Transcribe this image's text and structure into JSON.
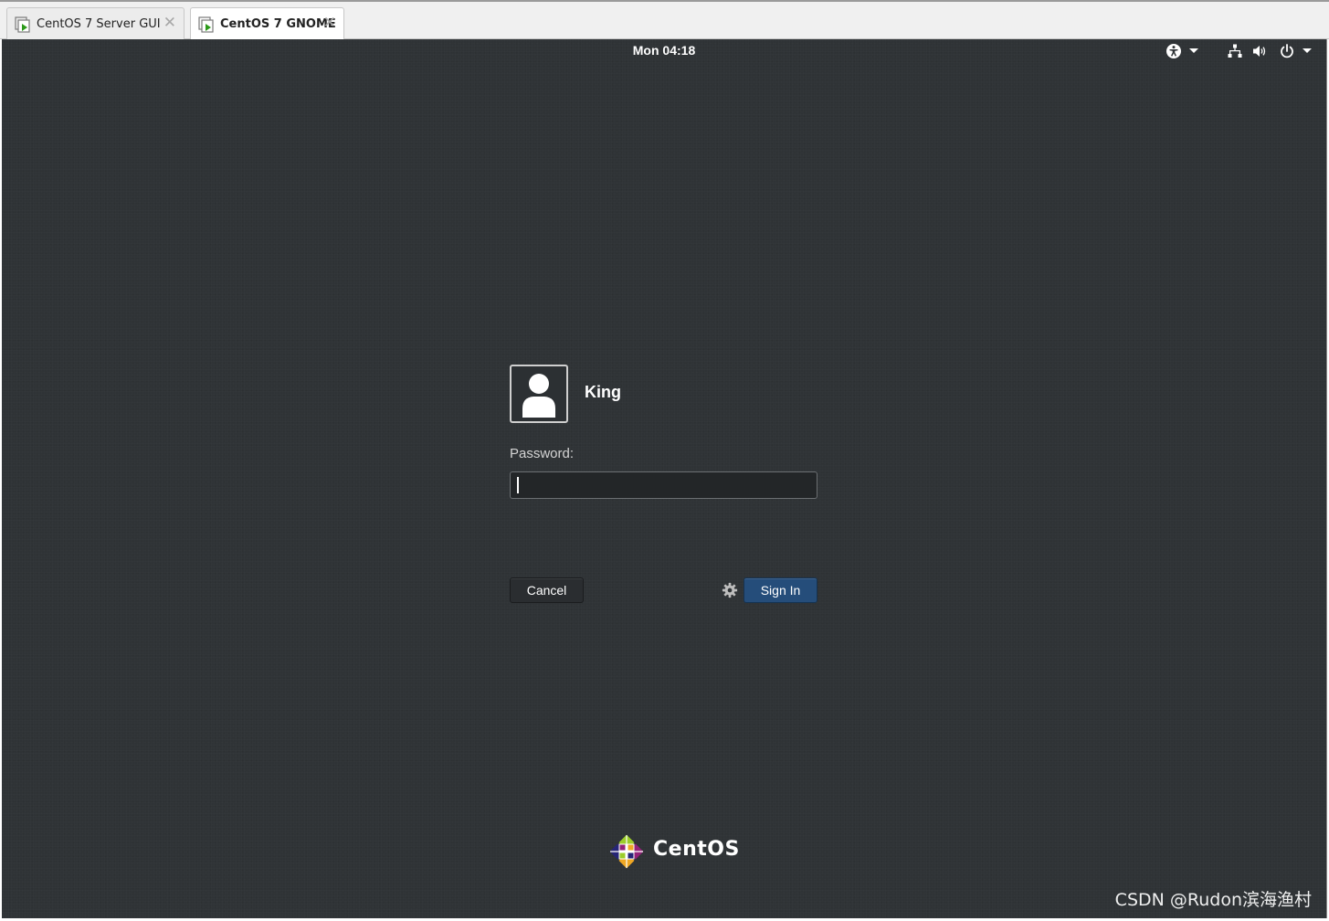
{
  "vm_tabs": [
    {
      "label": "CentOS 7 Server GUI",
      "active": false
    },
    {
      "label": "CentOS 7 GNOME",
      "active": true
    }
  ],
  "topbar": {
    "clock": "Mon 04:18",
    "icons": [
      "accessibility-icon",
      "network-icon",
      "volume-icon",
      "power-icon"
    ]
  },
  "login": {
    "username": "King",
    "password_label": "Password:",
    "password_value": "",
    "cancel_label": "Cancel",
    "signin_label": "Sign In",
    "session_icon": "gear-icon"
  },
  "branding": {
    "logo_text": "CentOS"
  },
  "watermark": "CSDN @Rudon滨海渔村",
  "colors": {
    "screen_background": "#2f3336",
    "signin_button": "#254d7a",
    "tab_bar": "#f0f0f0"
  }
}
